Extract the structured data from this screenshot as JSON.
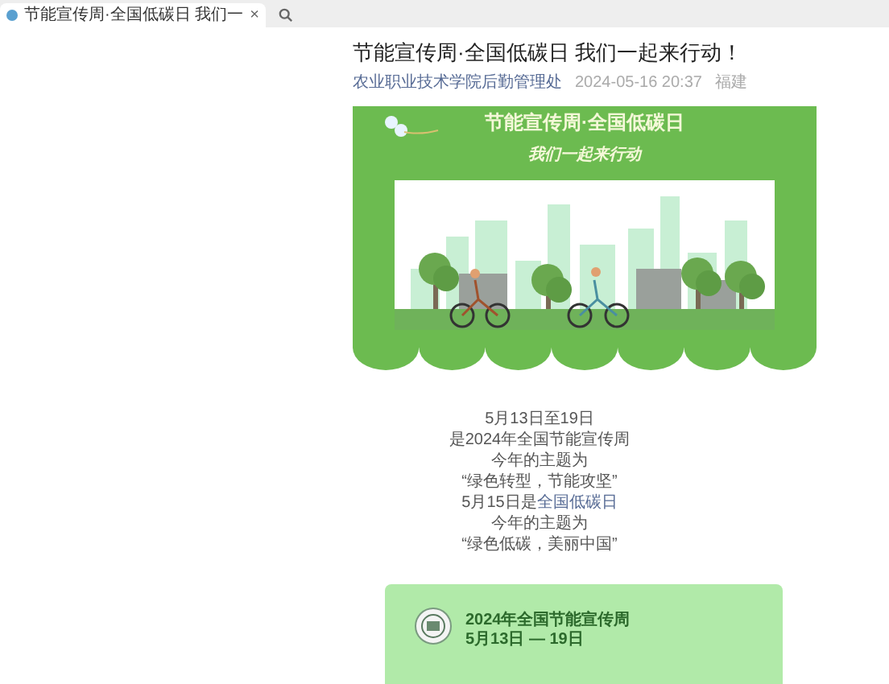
{
  "browser_tab": {
    "title": "节能宣传周·全国低碳日 我们一",
    "close": "×"
  },
  "article": {
    "title": "节能宣传周·全国低碳日 我们一起来行动！",
    "author": "农业职业技术学院后勤管理处",
    "date": "2024-05-16 20:37",
    "location": "福建"
  },
  "banner": {
    "title": "节能宣传周·全国低碳日",
    "subtitle": "我们一起来行动"
  },
  "body_lines": [
    {
      "text": "5月13日至19日"
    },
    {
      "text": "是2024年全国节能宣传周"
    },
    {
      "text": "今年的主题为"
    },
    {
      "text": "“绿色转型，节能攻坚”"
    },
    {
      "text": "5月15日是",
      "link": "全国低碳日"
    },
    {
      "text": "今年的主题为"
    },
    {
      "text": "“绿色低碳，美丽中国”"
    }
  ],
  "card": {
    "title": "2024年全国节能宣传周",
    "subtitle": "5月13日 — 19日"
  }
}
